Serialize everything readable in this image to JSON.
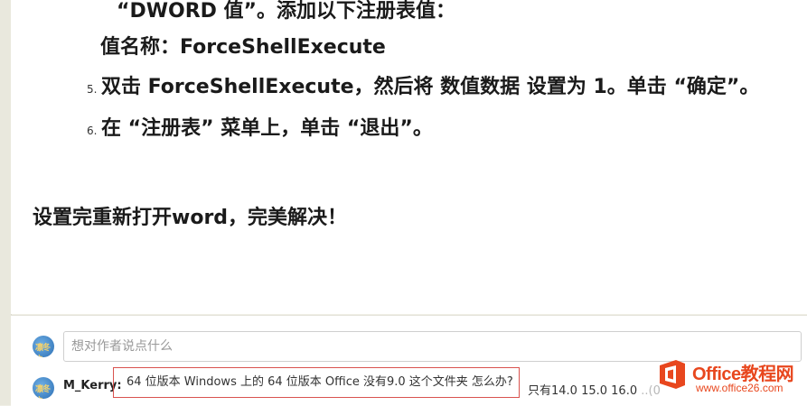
{
  "article": {
    "line_dword": "“DWORD 值”。添加以下注册表值：",
    "line_value_name": "值名称：ForceShellExecute",
    "steps": [
      {
        "num": "5.",
        "text": "双击 ForceShellExecute，然后将 数值数据 设置为 1。单击 “确定”。"
      },
      {
        "num": "6.",
        "text": "在 “注册表” 菜单上，单击 “退出”。"
      }
    ],
    "conclusion": "设置完重新打开word，完美解决！"
  },
  "comments": {
    "input_placeholder": "想对作者说点什么",
    "avatar_text": "凛冬之",
    "items": [
      {
        "user": "M_Kerry:",
        "highlighted_text": "64 位版本 Windows 上的 64 位版本 Office 没有9.0 这个文件夹 怎么办?",
        "tail_text": "只有14.0 15.0 16.0",
        "tail_faded": "..(0"
      }
    ]
  },
  "watermark": {
    "title": "Office教程网",
    "url": "www.office26.com",
    "icon": "office-logo-icon",
    "color": "#e8471e"
  }
}
